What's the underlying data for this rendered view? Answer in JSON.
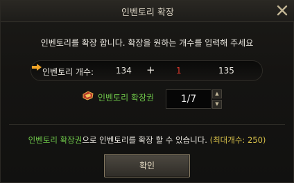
{
  "window": {
    "title": "인벤토리 확장"
  },
  "instruction": "인벤토리를 확장 합니다. 확장을 원하는 개수를 입력해 주세요",
  "calc": {
    "label": "인벤토리 개수:",
    "current": "134",
    "plus": "+",
    "add": "1",
    "result": "135"
  },
  "ticket": {
    "label": "인벤토리 확장권",
    "quantity": "1/7"
  },
  "footnote": {
    "item": "인벤토리 확장권",
    "text": "으로 인벤토리를 확장 할 수 있습니다.",
    "max": "(최대개수: 250)"
  },
  "buttons": {
    "confirm": "확인"
  },
  "colors": {
    "accent_green": "#6fc84a",
    "accent_red": "#e53b2e",
    "accent_gold": "#d8c14a",
    "arrow_orange": "#f0a428"
  },
  "icons": {
    "close": "close-icon",
    "arrow": "right-arrow-icon",
    "ticket": "ticket-icon"
  }
}
